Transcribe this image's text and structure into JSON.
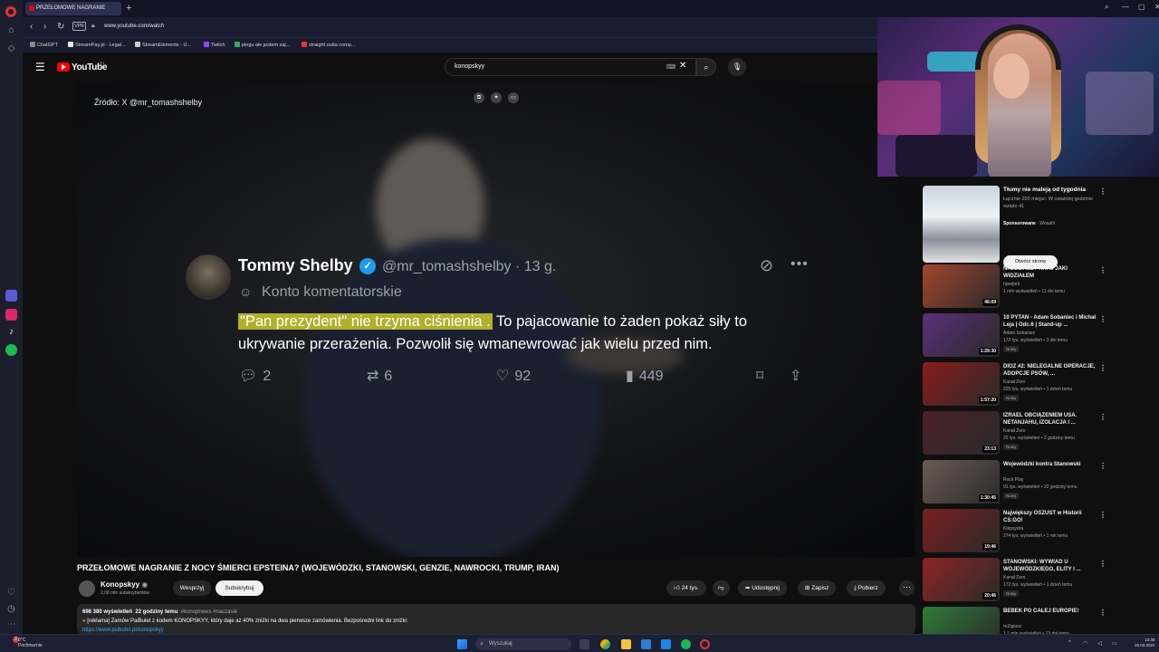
{
  "browser": {
    "tab_title": "PRZEŁOMOWE NAGRANIE",
    "new_tab": "+",
    "url": "www.youtube.com/watch",
    "vpn_label": "VPN",
    "bookmarks": [
      "ChatGPT",
      "StreamPay.pl - Legal...",
      "StreamElements - U...",
      "Twitch",
      "pingu ale jestem zaj...",
      "straight outta comp..."
    ]
  },
  "youtube": {
    "brand": "YouTube",
    "country": "PL",
    "search_query": "konopskyy"
  },
  "video": {
    "source": "Źródło: X @mr_tomashshelby",
    "tweet": {
      "name": "Tommy Shelby",
      "handle": "@mr_tomashshelby · 13 g.",
      "subtitle": "Konto komentatorskie",
      "highlight": "\"Pan prezydent\" nie trzyma ciśnienia .",
      "text_rest": " To pajacowanie to żaden pokaż siły to ukrywanie przerażenia. Pozwolił się wmanewrować jak wielu przed nim.",
      "replies": "2",
      "reposts": "6",
      "likes": "92",
      "views": "449"
    },
    "title": "PRZEŁOMOWE NAGRANIE Z NOCY ŚMIERCI EPSTEINA? (WOJEWÓDZKI, STANOWSKI, GENZIE, NAWROCKI, TRUMP, IRAN)",
    "channel": "Konopskyy",
    "subscribers": "2,08 mln subskrybentów",
    "support_label": "Wesprzyj",
    "subscribe_label": "Subskrybuj",
    "likes": "24 tys.",
    "share_label": "Udostępnij",
    "save_label": "Zapisz",
    "download_label": "Pobierz",
    "description": {
      "views": "698 380 wyświetleń",
      "time": "22 godziny temu",
      "tags": "#konopnews #naczasie",
      "line": "[reklama] Zamów PaiBulet z kodem KONOPSKYY, który daje aż 40% zniżki na dwa pierwsze zamówienia. Bezpośredni link do zniżki:",
      "link": "https://www.psibufet.pl/konopskyy"
    }
  },
  "ad": {
    "title": "Tłumy nie maleją od tygodnia",
    "desc": "Łącznie 200 miejsc. W ostatniej godzinie wzięto 41",
    "sponsored": "Sponsorowane",
    "advertiser": "Wosahl",
    "button": "Otwórz stronę"
  },
  "recommendations": [
    {
      "title": "NAJDZIKSZY KRAJ JAKI WIDZIAŁEM",
      "channel": "njwojtek",
      "meta": "1 mln wyświetleń • 11 dni temu",
      "duration": "46:09",
      "badge": "",
      "thumb_color": "#a4452e"
    },
    {
      "title": "10 PYTAŃ - Adam Sobaniec i Michał Leja | Odc.6 | Stand-up ...",
      "channel": "Adam Sobaniec",
      "meta": "172 tys. wyświetleń • 3 dni temu",
      "duration": "1:29:30",
      "badge": "Nowy",
      "thumb_color": "#5b2f7a"
    },
    {
      "title": "DIOZ #2: NIELEGALNE OPERACJE, ADOPCJE PSÓW, ...",
      "channel": "Kanał Zero",
      "meta": "225 tys. wyświetleń • 1 dzień temu",
      "duration": "1:57:20",
      "badge": "Nowy",
      "thumb_color": "#8a1b1b"
    },
    {
      "title": "IZRAEL OBCIĄŻENIEM USA. NETANJAHU, IZOLACJA I ...",
      "channel": "Kanał Zero",
      "meta": "25 tys. wyświetleń • 2 godziny temu",
      "duration": "23:13",
      "badge": "Nowy",
      "thumb_color": "#4b1f2a"
    },
    {
      "title": "Wojewódzki kontra Stanowski",
      "channel": "Rock Play",
      "meta": "91 tys. wyświetleń • 22 godziny temu",
      "duration": "1:30:45",
      "badge": "Nowy",
      "thumb_color": "#6b5a54"
    },
    {
      "title": "Największy OSZUST w Historii CS:GO!",
      "channel": "Klepsydra",
      "meta": "274 tys. wyświetleń • 1 rok temu",
      "duration": "19:46",
      "badge": "",
      "thumb_color": "#7a1e1e"
    },
    {
      "title": "STANOWSKI: WYWIAD U WOJEWÓDZKIEGO, ELITY I ...",
      "channel": "Kanał Zero",
      "meta": "172 tys. wyświetleń • 1 dzień temu",
      "duration": "20:46",
      "badge": "Nowy",
      "thumb_color": "#8e2424"
    },
    {
      "title": "BEBEK PO CAŁEJ EUROPIE!",
      "channel": "reZigiusz",
      "meta": "1,1 mln wyświetleń • 13 dni temu",
      "duration": "",
      "badge": "",
      "thumb_color": "#2f7a3a"
    }
  ],
  "taskbar": {
    "search_placeholder": "Wyszukaj",
    "weather_line1": "8°C",
    "weather_line2": "Pochmurnie",
    "time": "13:38",
    "date": "26.03.2024",
    "notifications": "2"
  },
  "colors": {
    "accent": "#ff0000",
    "highlight": "#b0b02a",
    "verified": "#1d9bf0",
    "link": "#3ea6ff"
  }
}
